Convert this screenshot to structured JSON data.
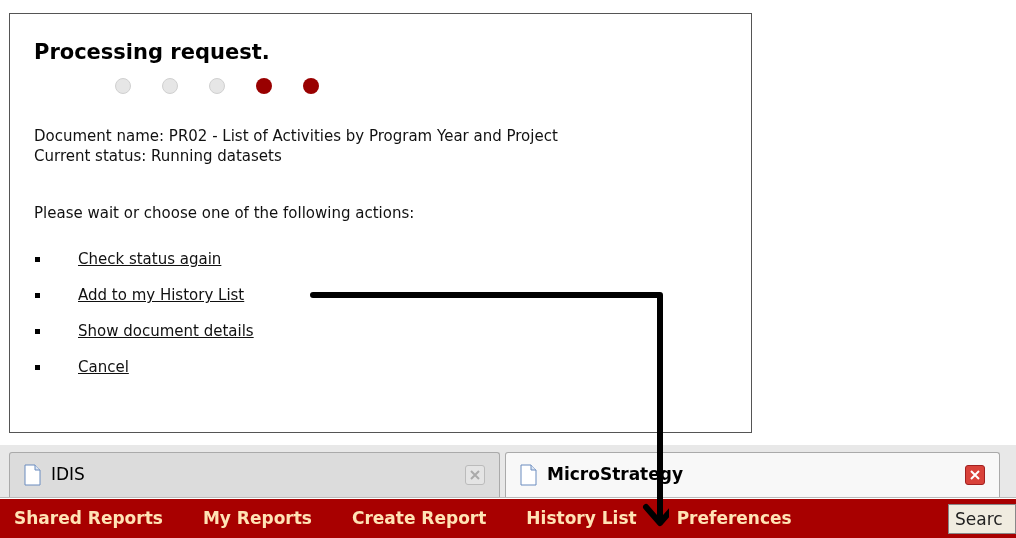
{
  "dialog": {
    "title": "Processing request.",
    "progress_dots": [
      {
        "on": false
      },
      {
        "on": false
      },
      {
        "on": false
      },
      {
        "on": true
      },
      {
        "on": true
      }
    ],
    "document_name": "Document name: PR02 - List of Activities by Program Year and Project",
    "current_status": "Current status: Running datasets",
    "prompt": "Please wait or choose one of the following actions:",
    "actions": [
      "Check status again",
      "Add to my History List",
      "Show document details",
      "Cancel"
    ]
  },
  "tabs": [
    {
      "label": "IDIS",
      "selected": false
    },
    {
      "label": "MicroStrategy",
      "selected": true
    }
  ],
  "nav": {
    "items": [
      "Shared Reports",
      "My Reports",
      "Create Report",
      "History List",
      "Preferences"
    ],
    "search_placeholder": "Searc"
  }
}
